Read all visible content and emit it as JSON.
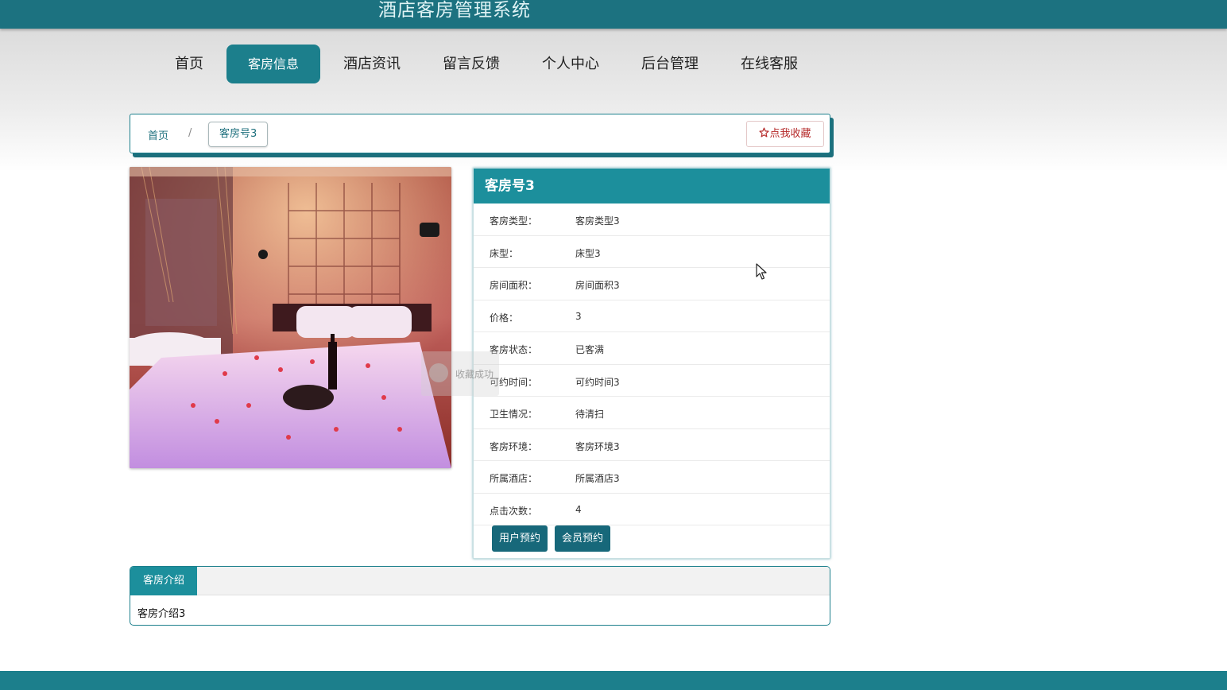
{
  "site": {
    "title": "酒店客房管理系统"
  },
  "nav": {
    "items": [
      {
        "label": "首页"
      },
      {
        "label": "客房信息",
        "active": true
      },
      {
        "label": "酒店资讯"
      },
      {
        "label": "留言反馈"
      },
      {
        "label": "个人中心"
      },
      {
        "label": "后台管理"
      },
      {
        "label": "在线客服"
      }
    ]
  },
  "breadcrumb": {
    "home": "首页",
    "separator": "/",
    "current": "客房号3",
    "favorite_label": "点我收藏",
    "favorite_icon": "star-outline-icon"
  },
  "room": {
    "title": "客房号3",
    "fields": [
      {
        "label": "客房类型：",
        "value": "客房类型3"
      },
      {
        "label": "床型：",
        "value": "床型3"
      },
      {
        "label": "房间面积：",
        "value": "房间面积3"
      },
      {
        "label": "价格：",
        "value": "3"
      },
      {
        "label": "客房状态：",
        "value": "已客满"
      },
      {
        "label": "可约时间：",
        "value": "可约时间3"
      },
      {
        "label": "卫生情况：",
        "value": "待清扫"
      },
      {
        "label": "客房环境：",
        "value": "客房环境3"
      },
      {
        "label": "所属酒店：",
        "value": "所属酒店3"
      },
      {
        "label": "点击次数：",
        "value": "4"
      }
    ],
    "actions": [
      {
        "label": "用户预约"
      },
      {
        "label": "会员预约"
      }
    ]
  },
  "toast": {
    "text": "收藏成功"
  },
  "intro": {
    "tab_label": "客房介绍",
    "content": "客房介绍3"
  },
  "colors": {
    "primary": "#1c7f8c",
    "header": "#1c7280",
    "title_bar": "#1c8f9c",
    "button": "#17687a",
    "favorite": "#b52a2a"
  }
}
